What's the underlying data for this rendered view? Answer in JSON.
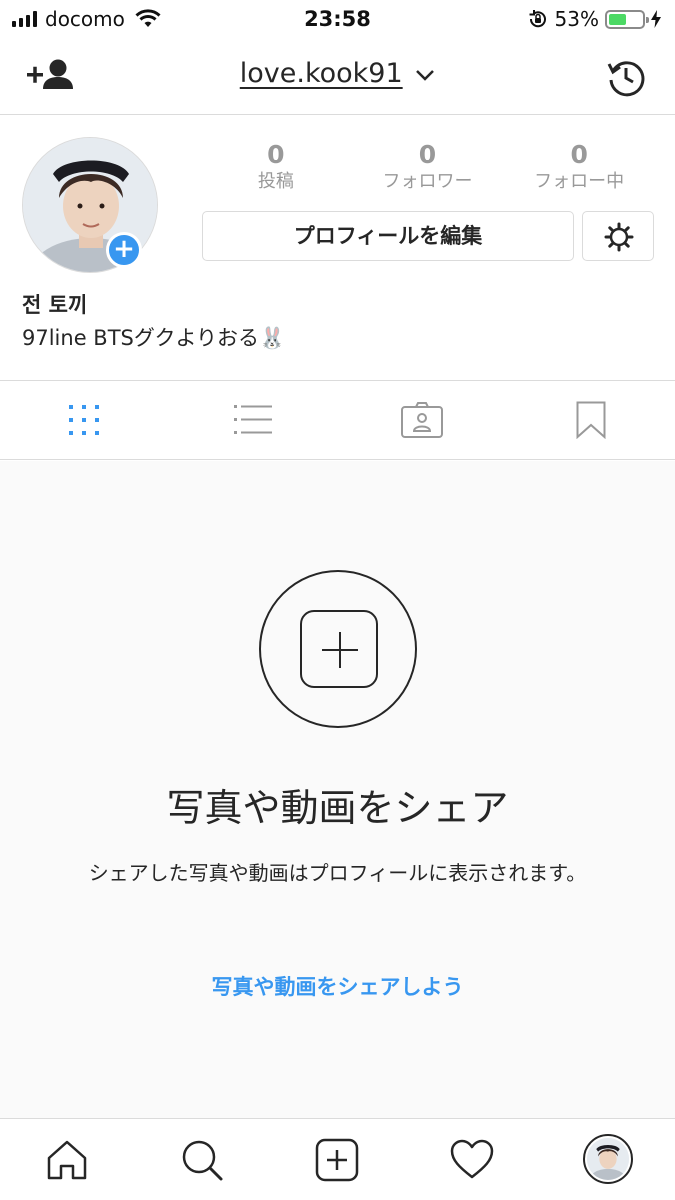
{
  "status_bar": {
    "carrier": "docomo",
    "time": "23:58",
    "battery_percent": "53%",
    "battery_level": 0.53
  },
  "nav": {
    "username": "love.kook91",
    "add_user_icon": "add-person-icon",
    "history_icon": "history-icon"
  },
  "profile": {
    "stats": [
      {
        "count": "0",
        "label": "投稿"
      },
      {
        "count": "0",
        "label": "フォロワー"
      },
      {
        "count": "0",
        "label": "フォロー中"
      }
    ],
    "edit_label": "プロフィールを編集",
    "add_story": "+",
    "name": "전 토끼",
    "bio": "97line BTSグクよりおる🐰"
  },
  "tabs": [
    "grid",
    "list",
    "tagged",
    "saved"
  ],
  "empty_state": {
    "title": "写真や動画をシェア",
    "description": "シェアした写真や動画はプロフィールに表示されます。",
    "link": "写真や動画をシェアしよう"
  },
  "bottom_nav": [
    "home",
    "search",
    "new-post",
    "activity",
    "profile"
  ],
  "colors": {
    "accent": "#3897f0",
    "border": "#dbdbdb",
    "battery": "#4cd964",
    "text": "#262626"
  }
}
